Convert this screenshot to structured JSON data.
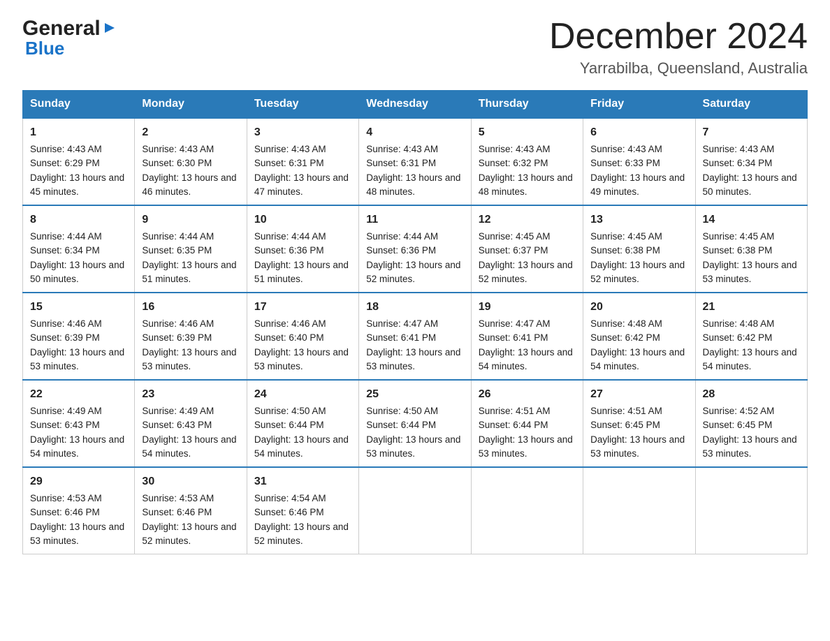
{
  "header": {
    "logo_general": "General",
    "logo_blue": "Blue",
    "main_title": "December 2024",
    "subtitle": "Yarrabilba, Queensland, Australia"
  },
  "calendar": {
    "days_of_week": [
      "Sunday",
      "Monday",
      "Tuesday",
      "Wednesday",
      "Thursday",
      "Friday",
      "Saturday"
    ],
    "weeks": [
      [
        {
          "day": "1",
          "sunrise": "4:43 AM",
          "sunset": "6:29 PM",
          "daylight": "13 hours and 45 minutes."
        },
        {
          "day": "2",
          "sunrise": "4:43 AM",
          "sunset": "6:30 PM",
          "daylight": "13 hours and 46 minutes."
        },
        {
          "day": "3",
          "sunrise": "4:43 AM",
          "sunset": "6:31 PM",
          "daylight": "13 hours and 47 minutes."
        },
        {
          "day": "4",
          "sunrise": "4:43 AM",
          "sunset": "6:31 PM",
          "daylight": "13 hours and 48 minutes."
        },
        {
          "day": "5",
          "sunrise": "4:43 AM",
          "sunset": "6:32 PM",
          "daylight": "13 hours and 48 minutes."
        },
        {
          "day": "6",
          "sunrise": "4:43 AM",
          "sunset": "6:33 PM",
          "daylight": "13 hours and 49 minutes."
        },
        {
          "day": "7",
          "sunrise": "4:43 AM",
          "sunset": "6:34 PM",
          "daylight": "13 hours and 50 minutes."
        }
      ],
      [
        {
          "day": "8",
          "sunrise": "4:44 AM",
          "sunset": "6:34 PM",
          "daylight": "13 hours and 50 minutes."
        },
        {
          "day": "9",
          "sunrise": "4:44 AM",
          "sunset": "6:35 PM",
          "daylight": "13 hours and 51 minutes."
        },
        {
          "day": "10",
          "sunrise": "4:44 AM",
          "sunset": "6:36 PM",
          "daylight": "13 hours and 51 minutes."
        },
        {
          "day": "11",
          "sunrise": "4:44 AM",
          "sunset": "6:36 PM",
          "daylight": "13 hours and 52 minutes."
        },
        {
          "day": "12",
          "sunrise": "4:45 AM",
          "sunset": "6:37 PM",
          "daylight": "13 hours and 52 minutes."
        },
        {
          "day": "13",
          "sunrise": "4:45 AM",
          "sunset": "6:38 PM",
          "daylight": "13 hours and 52 minutes."
        },
        {
          "day": "14",
          "sunrise": "4:45 AM",
          "sunset": "6:38 PM",
          "daylight": "13 hours and 53 minutes."
        }
      ],
      [
        {
          "day": "15",
          "sunrise": "4:46 AM",
          "sunset": "6:39 PM",
          "daylight": "13 hours and 53 minutes."
        },
        {
          "day": "16",
          "sunrise": "4:46 AM",
          "sunset": "6:39 PM",
          "daylight": "13 hours and 53 minutes."
        },
        {
          "day": "17",
          "sunrise": "4:46 AM",
          "sunset": "6:40 PM",
          "daylight": "13 hours and 53 minutes."
        },
        {
          "day": "18",
          "sunrise": "4:47 AM",
          "sunset": "6:41 PM",
          "daylight": "13 hours and 53 minutes."
        },
        {
          "day": "19",
          "sunrise": "4:47 AM",
          "sunset": "6:41 PM",
          "daylight": "13 hours and 54 minutes."
        },
        {
          "day": "20",
          "sunrise": "4:48 AM",
          "sunset": "6:42 PM",
          "daylight": "13 hours and 54 minutes."
        },
        {
          "day": "21",
          "sunrise": "4:48 AM",
          "sunset": "6:42 PM",
          "daylight": "13 hours and 54 minutes."
        }
      ],
      [
        {
          "day": "22",
          "sunrise": "4:49 AM",
          "sunset": "6:43 PM",
          "daylight": "13 hours and 54 minutes."
        },
        {
          "day": "23",
          "sunrise": "4:49 AM",
          "sunset": "6:43 PM",
          "daylight": "13 hours and 54 minutes."
        },
        {
          "day": "24",
          "sunrise": "4:50 AM",
          "sunset": "6:44 PM",
          "daylight": "13 hours and 54 minutes."
        },
        {
          "day": "25",
          "sunrise": "4:50 AM",
          "sunset": "6:44 PM",
          "daylight": "13 hours and 53 minutes."
        },
        {
          "day": "26",
          "sunrise": "4:51 AM",
          "sunset": "6:44 PM",
          "daylight": "13 hours and 53 minutes."
        },
        {
          "day": "27",
          "sunrise": "4:51 AM",
          "sunset": "6:45 PM",
          "daylight": "13 hours and 53 minutes."
        },
        {
          "day": "28",
          "sunrise": "4:52 AM",
          "sunset": "6:45 PM",
          "daylight": "13 hours and 53 minutes."
        }
      ],
      [
        {
          "day": "29",
          "sunrise": "4:53 AM",
          "sunset": "6:46 PM",
          "daylight": "13 hours and 53 minutes."
        },
        {
          "day": "30",
          "sunrise": "4:53 AM",
          "sunset": "6:46 PM",
          "daylight": "13 hours and 52 minutes."
        },
        {
          "day": "31",
          "sunrise": "4:54 AM",
          "sunset": "6:46 PM",
          "daylight": "13 hours and 52 minutes."
        },
        null,
        null,
        null,
        null
      ]
    ]
  }
}
